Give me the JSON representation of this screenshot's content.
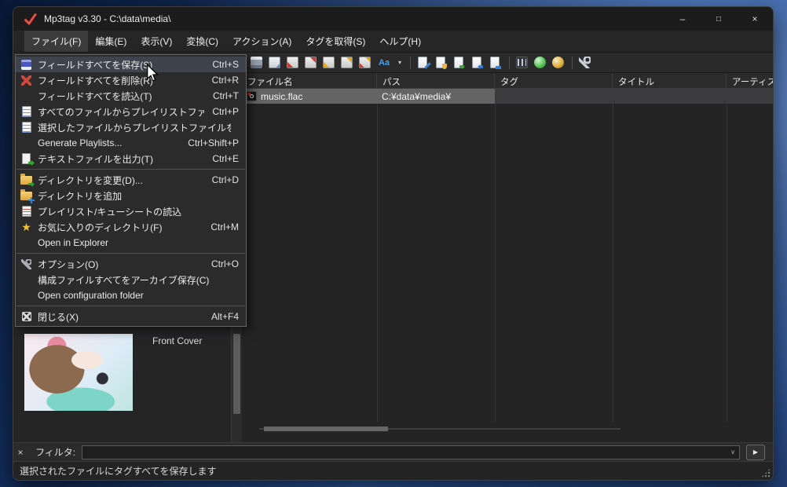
{
  "colors": {
    "desktop_blue": "#2c58a0",
    "titlebar": "#1c1c1c",
    "menu_highlight": "#3f434d",
    "selected_row": "#646464",
    "accent_red": "#d2392e",
    "accent_gold": "#e3a91c"
  },
  "window": {
    "title": "Mp3tag v3.30 - C:\\data\\media\\",
    "caption_buttons": {
      "minimize": "–",
      "maximize": "□",
      "close": "×"
    }
  },
  "menubar": {
    "items": [
      {
        "label": "ファイル(F)"
      },
      {
        "label": "編集(E)"
      },
      {
        "label": "表示(V)"
      },
      {
        "label": "変換(C)"
      },
      {
        "label": "アクション(A)"
      },
      {
        "label": "タグを取得(S)"
      },
      {
        "label": "ヘルプ(H)"
      }
    ]
  },
  "toolbar": {
    "icon_names": [
      "printer-icon",
      "print-preview-icon",
      "tag-cut-icon",
      "tag-copy-icon",
      "tag-paste-icon",
      "tag-undo-icon",
      "tag-redo-icon",
      "case-conversion-icon",
      "case-dropdown-chevron",
      "text-edit-icon",
      "playlist-file-icon",
      "export-icon",
      "import-icon",
      "columns-icon",
      "extended-tags-icon",
      "web-source-green-icon",
      "web-source-gold-icon",
      "options-key-icon"
    ],
    "case_glyph": "Aa",
    "chevron_glyph": "▾"
  },
  "file_menu": {
    "items": [
      {
        "label": "フィールドすべてを保存(S)",
        "shortcut": "Ctrl+S",
        "icon": "save-icon",
        "highlighted": true
      },
      {
        "label": "フィールドすべてを削除(R)",
        "shortcut": "Ctrl+R",
        "icon": "delete-icon"
      },
      {
        "label": "フィールドすべてを読込(T)",
        "shortcut": "Ctrl+T",
        "icon": ""
      },
      {
        "label": "すべてのファイルからプレイリストファイルを作成",
        "shortcut": "Ctrl+P",
        "icon": "playlist-icon"
      },
      {
        "label": "選択したファイルからプレイリストファイルを作成",
        "shortcut": "",
        "icon": "playlist-icon"
      },
      {
        "label": "Generate Playlists...",
        "shortcut": "Ctrl+Shift+P",
        "icon": ""
      },
      {
        "label": "テキストファイルを出力(T)",
        "shortcut": "Ctrl+E",
        "icon": "doc-export-icon"
      },
      {
        "separator": true
      },
      {
        "label": "ディレクトリを変更(D)...",
        "shortcut": "Ctrl+D",
        "icon": "folder-change-icon"
      },
      {
        "label": "ディレクトリを追加",
        "shortcut": "",
        "icon": "folder-add-icon"
      },
      {
        "label": "プレイリスト/キューシートの読込",
        "shortcut": "",
        "icon": "playlist-load-icon"
      },
      {
        "label": "お気に入りのディレクトリ(F)",
        "shortcut": "Ctrl+M",
        "icon": "star-icon"
      },
      {
        "label": "Open in Explorer",
        "shortcut": "",
        "icon": ""
      },
      {
        "separator": true
      },
      {
        "label": "オプション(O)",
        "shortcut": "Ctrl+O",
        "icon": "wrench-icon"
      },
      {
        "label": "構成ファイルすべてをアーカイブ保存(C)",
        "shortcut": "",
        "icon": ""
      },
      {
        "label": "Open configuration folder",
        "shortcut": "",
        "icon": ""
      },
      {
        "separator": true
      },
      {
        "label": "閉じる(X)",
        "shortcut": "Alt+F4",
        "icon": "close-box-icon"
      }
    ]
  },
  "tag_panel": {
    "cover_label": "Front Cover"
  },
  "filelist": {
    "columns": [
      {
        "label": "ファイル名"
      },
      {
        "label": "パス"
      },
      {
        "label": "タグ"
      },
      {
        "label": "タイトル"
      },
      {
        "label": "アーティスト"
      }
    ],
    "rows": [
      {
        "filename": "music.flac",
        "path": "C:¥data¥media¥",
        "tag": "",
        "title": "",
        "artist": "",
        "selected": true,
        "icon": "flac-file-icon"
      }
    ]
  },
  "filter": {
    "close_glyph": "×",
    "label": "フィルタ:",
    "value": "",
    "chevron_glyph": "∨",
    "go_glyph": "▶"
  },
  "statusbar": {
    "text": "選択されたファイルにタグすべてを保存します"
  }
}
